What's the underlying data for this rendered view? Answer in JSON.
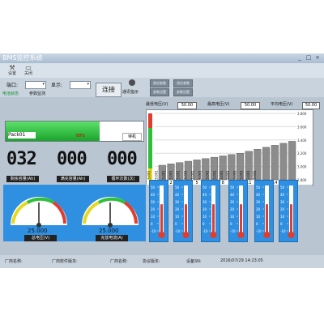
{
  "window": {
    "title": "BMS监控系统",
    "minimize": "_",
    "maximize": "□",
    "close": "×"
  },
  "menu": [
    {
      "icon": "tools-icon",
      "glyph": "⚒",
      "label": "设置"
    },
    {
      "icon": "door-icon",
      "glyph": "▭",
      "label": "关闭"
    }
  ],
  "controls": {
    "port_label": "端口:",
    "port_value": "",
    "display_label": "显示:",
    "display_value": "",
    "connect_label": "连接",
    "status_label": "通讯指示",
    "buttons": [
      "测试参数",
      "参数设置",
      "测试参数",
      "参数设置"
    ]
  },
  "tabs": [
    "电池状态",
    "参数监测"
  ],
  "pack": {
    "name": "Pack01",
    "percent": "68%",
    "state": "待机",
    "fill_fraction": 0.68
  },
  "readouts": [
    {
      "value": "032",
      "label": "剩余容量(Ah)"
    },
    {
      "value": "000",
      "label": "满充容量(Ah)"
    },
    {
      "value": "000",
      "label": "循环次数(次)"
    }
  ],
  "gauges": [
    {
      "value": "25.000",
      "label": "总电压(V)",
      "min": "0",
      "max": "50"
    },
    {
      "value": "25.000",
      "label": "充放电流(A)",
      "min": "0",
      "max": "50"
    }
  ],
  "voltages": {
    "max_label": "最低电压(V)",
    "max_value": "50.00",
    "min_label": "最高电压(V)",
    "min_value": "50.00",
    "avg_label": "平均电压(V)",
    "avg_value": "50.00"
  },
  "colors": {
    "accent": "#2f8fe1",
    "fill_green": "#2cbf3c",
    "bar_gray": "#8c8c8c"
  },
  "chart_data": {
    "type": "bar",
    "categories": [
      "1",
      "2",
      "3",
      "4",
      "5",
      "6",
      "7",
      "8",
      "9",
      "10",
      "11",
      "12",
      "13",
      "14",
      "15",
      "16"
    ],
    "values": [
      3.001,
      3.001,
      3.001,
      3.001,
      3.001,
      3.001,
      3.001,
      3.001,
      3.001,
      3.001,
      3.001,
      3.001,
      3.001,
      3.001,
      3.001,
      3.001
    ],
    "display_heights": [
      0.22,
      0.24,
      0.26,
      0.28,
      0.3,
      0.32,
      0.34,
      0.36,
      0.38,
      0.4,
      0.43,
      0.46,
      0.49,
      0.52,
      0.55,
      0.58
    ],
    "yticks": [
      "3.800",
      "3.600",
      "3.400",
      "3.200",
      "3.000",
      "2.800"
    ],
    "title": "",
    "xlabel": "",
    "ylabel": ""
  },
  "temps": [
    {
      "scale": [
        "50",
        "40",
        "30",
        "20",
        "10",
        "0",
        "-10"
      ],
      "level": 0.6
    },
    {
      "scale": [
        "50",
        "40",
        "30",
        "20",
        "10",
        "0",
        "-10"
      ],
      "level": 0.6
    },
    {
      "scale": [
        "50",
        "40",
        "30",
        "20",
        "10",
        "0",
        "-10"
      ],
      "level": 0.6
    },
    {
      "scale": [
        "50",
        "40",
        "30",
        "20",
        "10",
        "0",
        "-10"
      ],
      "level": 0.6
    },
    {
      "scale": [
        "50",
        "40",
        "30",
        "20",
        "10",
        "0",
        "-10"
      ],
      "level": 0.6
    },
    {
      "scale": [
        "50",
        "40",
        "30",
        "20",
        "10",
        "0",
        "-10"
      ],
      "level": 0.6
    }
  ],
  "status": {
    "vendor": "厂商名称:",
    "fw": "厂商软件版本:",
    "vendor2": "厂商名称:",
    "proto": "协议版本:",
    "device": "设备SN:",
    "datetime": "2016/07/29 14:23:05"
  }
}
